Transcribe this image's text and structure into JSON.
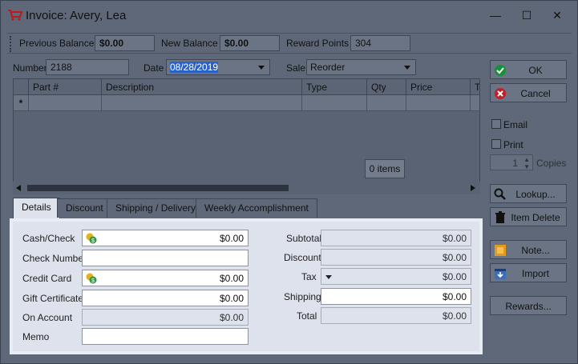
{
  "window": {
    "title": "Invoice: Avery, Lea"
  },
  "summary": {
    "previous_balance_label": "Previous Balance",
    "previous_balance": "$0.00",
    "new_balance_label": "New Balance",
    "new_balance": "$0.00",
    "reward_points_label": "Reward Points",
    "reward_points": "304"
  },
  "header": {
    "number_label": "Number",
    "number": "2188",
    "date_label": "Date",
    "date": "08/28/2019",
    "sale_label": "Sale",
    "sale": "Reorder"
  },
  "grid": {
    "columns": [
      "Part #",
      "Description",
      "Type",
      "Qty",
      "Price",
      "To"
    ],
    "new_row_marker": "*",
    "items_count": "0 items"
  },
  "tabs": [
    "Details",
    "Discount",
    "Shipping / Delivery",
    "Weekly Accomplishment"
  ],
  "details": {
    "cash_check_label": "Cash/Check",
    "cash_check": "$0.00",
    "check_number_label": "Check Number",
    "check_number": "",
    "credit_card_label": "Credit Card",
    "credit_card": "$0.00",
    "gift_certificate_label": "Gift Certificate",
    "gift_certificate": "$0.00",
    "on_account_label": "On Account",
    "on_account": "$0.00",
    "memo_label": "Memo",
    "memo": "",
    "subtotal_label": "Subtotal",
    "subtotal": "$0.00",
    "discount_label": "Discount",
    "discount": "$0.00",
    "tax_label": "Tax",
    "tax": "$0.00",
    "shipping_label": "Shipping",
    "shipping": "$0.00",
    "total_label": "Total",
    "total": "$0.00"
  },
  "sidebar": {
    "ok": "OK",
    "cancel": "Cancel",
    "email": "Email",
    "print": "Print",
    "copies_value": "1",
    "copies_label": "Copies",
    "lookup": "Lookup...",
    "item_delete": "Item Delete",
    "note": "Note...",
    "import": "Import",
    "rewards": "Rewards..."
  },
  "colors": {
    "ok_green": "#1a8f3a",
    "cancel_red": "#c0202a",
    "panel": "#dde2ec",
    "selection": "#2a62c8"
  }
}
